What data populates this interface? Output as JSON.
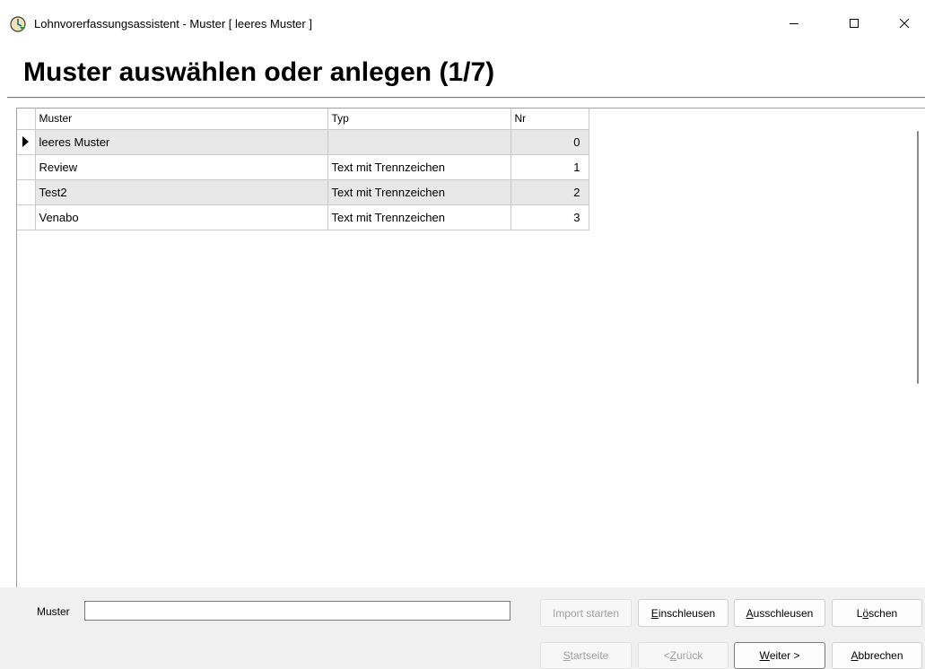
{
  "window": {
    "title": "Lohnvorerfassungsassistent - Muster [ leeres Muster ]"
  },
  "header": {
    "title": "Muster auswählen oder anlegen (1/7)"
  },
  "grid": {
    "columns": [
      "Muster",
      "Typ",
      "Nr"
    ],
    "rows": [
      {
        "muster": "leeres Muster",
        "typ": "",
        "nr": "0"
      },
      {
        "muster": "Review",
        "typ": "Text mit Trennzeichen",
        "nr": "1"
      },
      {
        "muster": "Test2",
        "typ": "Text mit Trennzeichen",
        "nr": "2"
      },
      {
        "muster": "Venabo",
        "typ": "Text mit Trennzeichen",
        "nr": "3"
      }
    ]
  },
  "form": {
    "muster_label": "Muster",
    "muster_value": ""
  },
  "buttons": {
    "import_pre": "Import starten",
    "einschleusen_key": "E",
    "einschleusen_rest": "inschleusen",
    "ausschleusen_key": "A",
    "ausschleusen_rest": "usschleusen",
    "loeschen_pre": "L",
    "loeschen_key": "ö",
    "loeschen_rest": "schen",
    "startseite_key": "S",
    "startseite_rest": "tartseite",
    "zurueck_pre": "< ",
    "zurueck_key": "Z",
    "zurueck_rest": "urück",
    "weiter_key": "W",
    "weiter_rest": "eiter >",
    "abbrechen_key": "A",
    "abbrechen_rest": "bbrechen"
  },
  "icons": {
    "app": "clock-arrow-icon",
    "minimize": "minimize-icon",
    "maximize": "maximize-icon",
    "close": "close-icon",
    "row_pointer": "current-row-arrow-icon"
  },
  "colors": {
    "alt_row": "#e8e8e8",
    "disabled_text": "#a0a0a0"
  }
}
